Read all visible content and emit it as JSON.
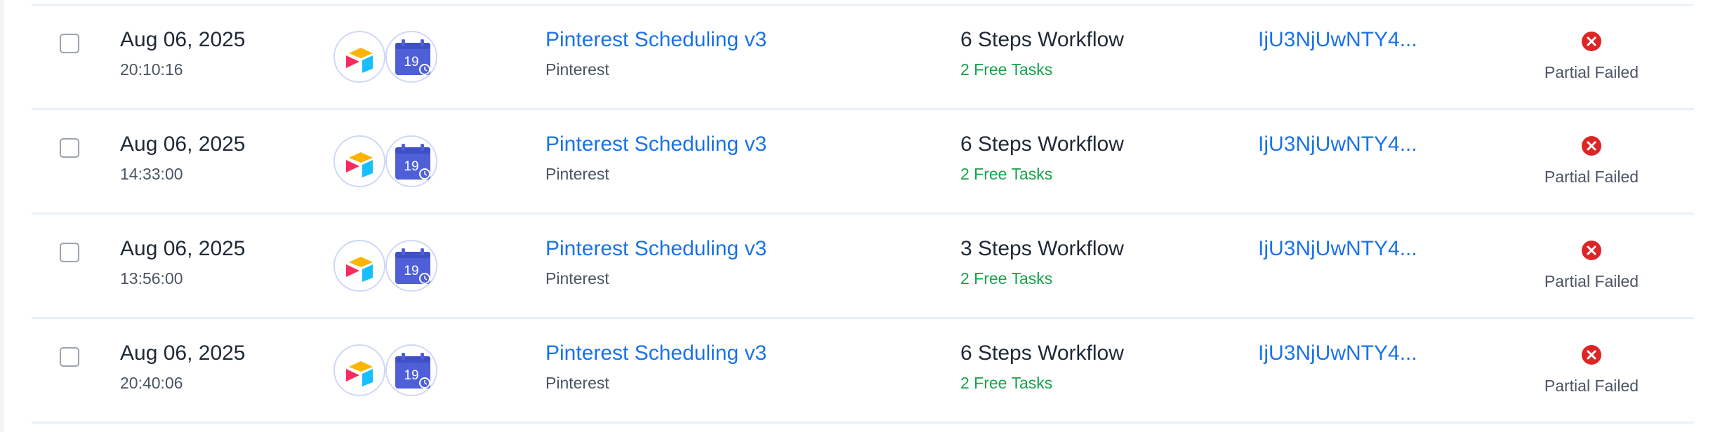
{
  "colors": {
    "link": "#1a73e8",
    "free_tasks": "#16a34a",
    "error": "#dc2626"
  },
  "rows": [
    {
      "date": "Aug 06, 2025",
      "time": "20:10:16",
      "app_icons": [
        "airtable-icon",
        "schedule-calendar-icon"
      ],
      "calendar_day": "19",
      "flow_name": "Pinterest Scheduling v3",
      "flow_app": "Pinterest",
      "steps": "6 Steps Workflow",
      "tasks": "2 Free Tasks",
      "run_id": "IjU3NjUwNTY4...",
      "status": "Partial Failed",
      "status_icon": "error-circle-icon"
    },
    {
      "date": "Aug 06, 2025",
      "time": "14:33:00",
      "app_icons": [
        "airtable-icon",
        "schedule-calendar-icon"
      ],
      "calendar_day": "19",
      "flow_name": "Pinterest Scheduling v3",
      "flow_app": "Pinterest",
      "steps": "6 Steps Workflow",
      "tasks": "2 Free Tasks",
      "run_id": "IjU3NjUwNTY4...",
      "status": "Partial Failed",
      "status_icon": "error-circle-icon"
    },
    {
      "date": "Aug 06, 2025",
      "time": "13:56:00",
      "app_icons": [
        "airtable-icon",
        "schedule-calendar-icon"
      ],
      "calendar_day": "19",
      "flow_name": "Pinterest Scheduling v3",
      "flow_app": "Pinterest",
      "steps": "3 Steps Workflow",
      "tasks": "2 Free Tasks",
      "run_id": "IjU3NjUwNTY4...",
      "status": "Partial Failed",
      "status_icon": "error-circle-icon"
    },
    {
      "date": "Aug 06, 2025",
      "time": "20:40:06",
      "app_icons": [
        "airtable-icon",
        "schedule-calendar-icon"
      ],
      "calendar_day": "19",
      "flow_name": "Pinterest Scheduling v3",
      "flow_app": "Pinterest",
      "steps": "6 Steps Workflow",
      "tasks": "2 Free Tasks",
      "run_id": "IjU3NjUwNTY4...",
      "status": "Partial Failed",
      "status_icon": "error-circle-icon"
    }
  ]
}
